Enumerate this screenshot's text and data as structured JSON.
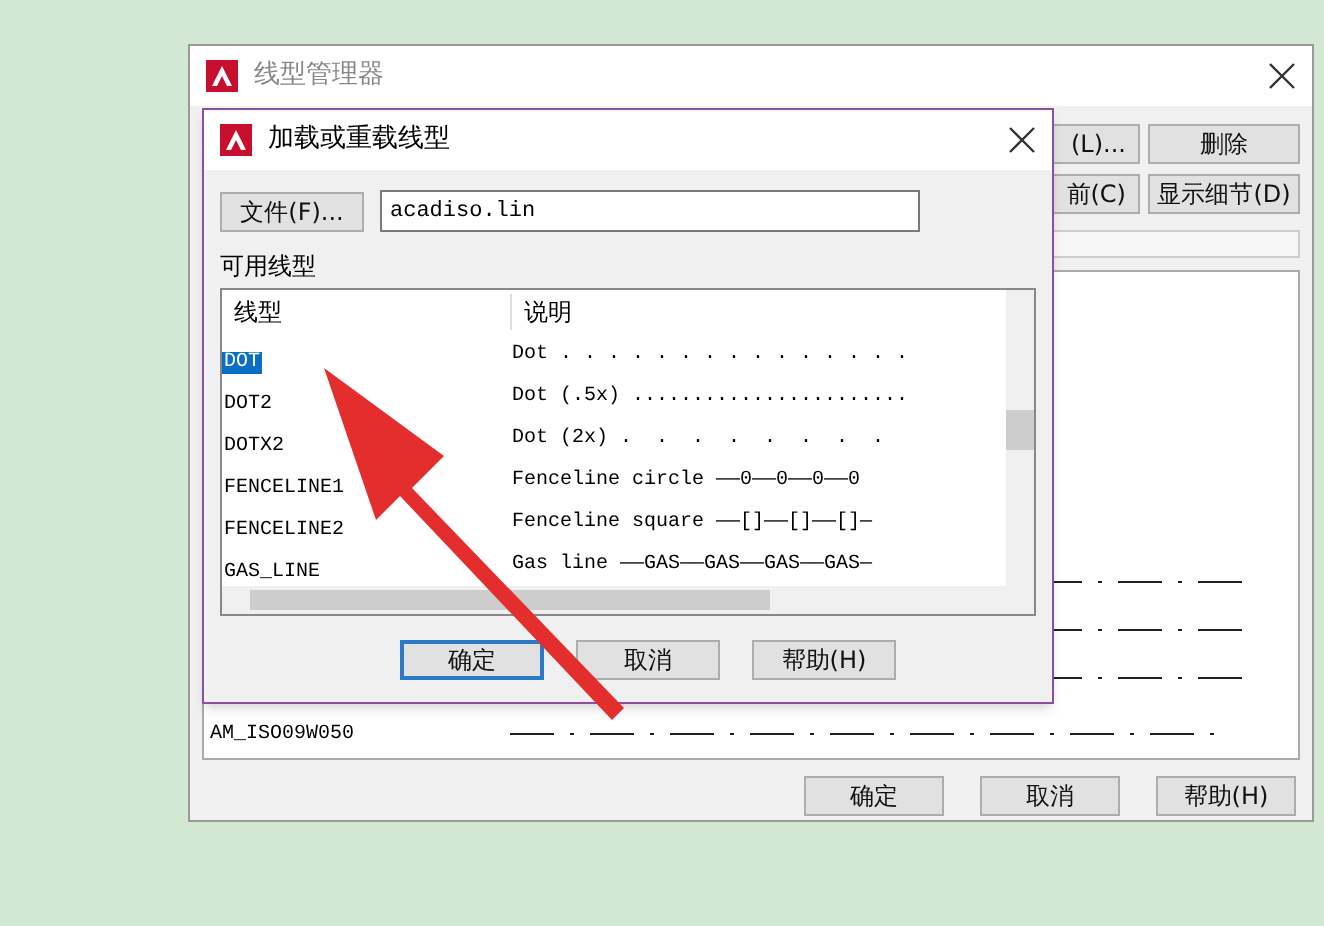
{
  "manager": {
    "title": "线型管理器",
    "top_buttons": [
      "(L)...",
      "删除",
      "前(C)",
      "显示细节(D)"
    ],
    "rows": [
      {
        "name": "AM_ISO09W050"
      }
    ],
    "buttons": [
      {
        "label": "确定"
      },
      {
        "label": "取消"
      },
      {
        "label": "帮助(H)"
      }
    ]
  },
  "load_dialog": {
    "title": "加载或重载线型",
    "file_button": "文件(F)...",
    "file_field": {
      "value": "acadiso.lin"
    },
    "section_label": "可用线型",
    "columns": [
      "线型",
      "说明"
    ],
    "rows": [
      {
        "name": "DOT",
        "description": "Dot . . . . . . . . . . . . . . .",
        "selected": true
      },
      {
        "name": "DOT2",
        "description": "Dot (.5x) .......................",
        "selected": false
      },
      {
        "name": "DOTX2",
        "description": "Dot (2x) .  .  .  .  .  .  .  .",
        "selected": false
      },
      {
        "name": "FENCELINE1",
        "description": "Fenceline circle ——0——0——0——0",
        "selected": false
      },
      {
        "name": "FENCELINE2",
        "description": "Fenceline square ——[]——[]——[]—",
        "selected": false
      },
      {
        "name": "GAS_LINE",
        "description": "Gas line ——GAS——GAS——GAS——GAS—",
        "selected": false
      }
    ],
    "buttons": [
      {
        "label": "确定",
        "focused": true
      },
      {
        "label": "取消",
        "focused": false
      },
      {
        "label": "帮助(H)",
        "focused": false
      }
    ]
  }
}
